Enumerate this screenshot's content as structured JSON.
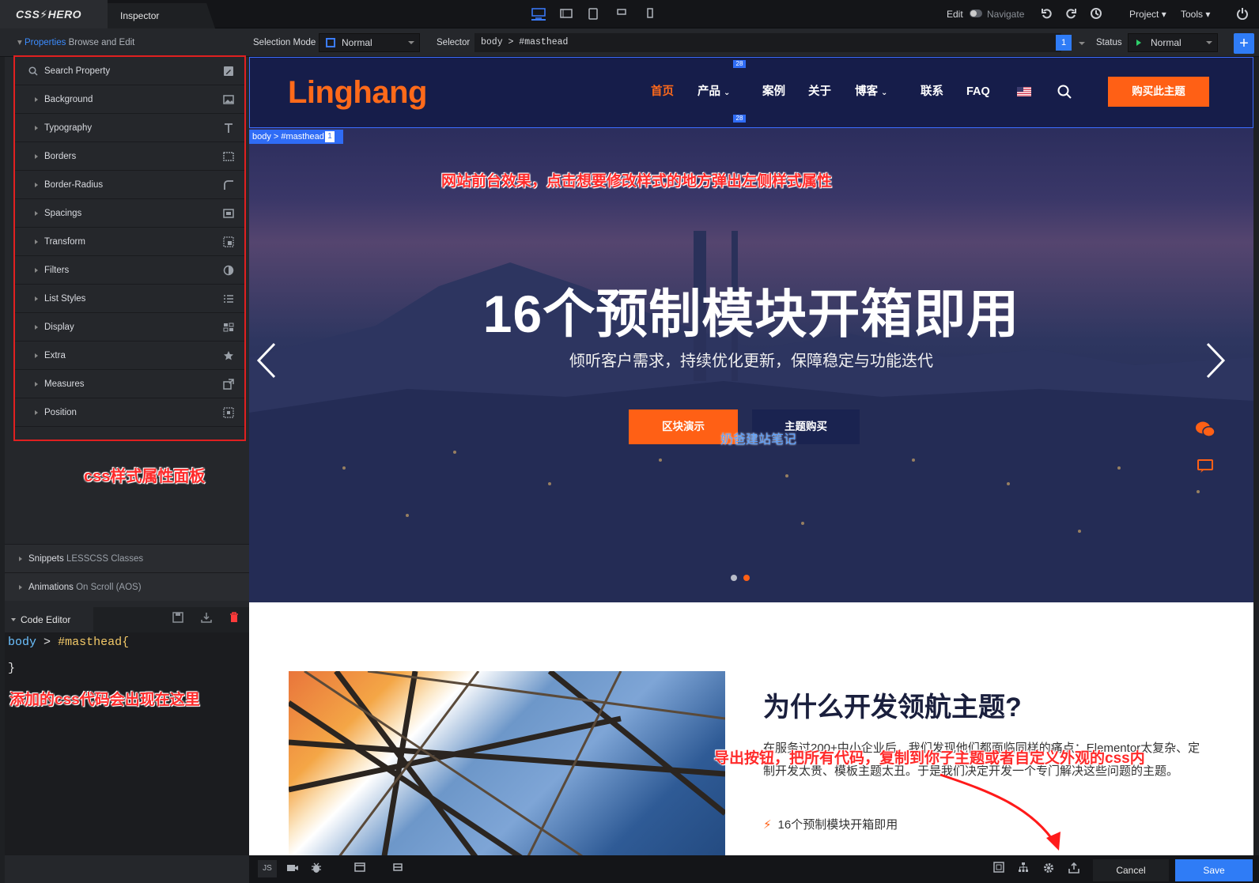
{
  "app": {
    "logo": "CSS⚡HERO",
    "tab_label": "Inspector"
  },
  "toolbar": {
    "edit_label": "Edit",
    "navigate_label": "Navigate",
    "project_label": "Project",
    "tools_label": "Tools"
  },
  "bar2": {
    "properties_label": "Properties",
    "properties_sub": "Browse and Edit",
    "selection_mode_label": "Selection Mode",
    "selection_mode_value": "Normal",
    "selector_label": "Selector",
    "selector_value": "body  >  #masthead",
    "selector_count": "1",
    "status_label": "Status",
    "status_value": "Normal",
    "add_label": "+"
  },
  "properties": {
    "search_placeholder": "Search Property",
    "items": [
      {
        "label": "Background",
        "icon": "image-icon"
      },
      {
        "label": "Typography",
        "icon": "text-icon"
      },
      {
        "label": "Borders",
        "icon": "border-icon"
      },
      {
        "label": "Border-Radius",
        "icon": "radius-icon"
      },
      {
        "label": "Spacings",
        "icon": "spacing-icon"
      },
      {
        "label": "Transform",
        "icon": "transform-icon"
      },
      {
        "label": "Filters",
        "icon": "filter-icon"
      },
      {
        "label": "List Styles",
        "icon": "list-icon"
      },
      {
        "label": "Display",
        "icon": "display-icon"
      },
      {
        "label": "Extra",
        "icon": "star-icon"
      },
      {
        "label": "Measures",
        "icon": "measure-icon"
      },
      {
        "label": "Position",
        "icon": "position-icon"
      }
    ]
  },
  "annotations": {
    "panel": "css样式属性面板",
    "site": "网站前台效果，点击想要修改样式的地方弹出左侧样式属性",
    "code": "添加的css代码会出现在这里",
    "export": "导出按钮，把所有代码，复制到你子主题或者自定义外观的css内"
  },
  "accordions": {
    "snippets": {
      "label": "Snippets",
      "sub": "LESSCSS Classes"
    },
    "animations": {
      "label": "Animations",
      "sub": "On Scroll (AOS)"
    }
  },
  "code_editor": {
    "title": "Code Editor",
    "selector": "body",
    "combinator": ">",
    "id": "#masthead{",
    "close": "}"
  },
  "site": {
    "brand": "Linghang",
    "nav": [
      "首页",
      "产品",
      "案例",
      "关于",
      "博客",
      "联系",
      "FAQ"
    ],
    "buy_button": "购买此主题",
    "spacing_tag": "28",
    "crumb": "body > #masthead",
    "crumb_count": "1",
    "hero_title": "16个预制模块开箱即用",
    "hero_subtitle": "倾听客户需求，持续优化更新，保障稳定与功能迭代",
    "btn_demo": "区块演示",
    "btn_buy": "主题购买",
    "watermark": "奶爸建站笔记",
    "about_title": "为什么开发领航主题?",
    "about_text": "在服务过200+中小企业后，我们发现他们都面临同样的痛点：Elementor太复杂、定制开发太贵、模板主题太丑。于是我们决定开发一个专门解决这些问题的主题。",
    "feature_1": "16个预制模块开箱即用"
  },
  "bottom": {
    "js_label": "JS",
    "cancel": "Cancel",
    "save": "Save"
  },
  "colors": {
    "accent": "#2f7cf6",
    "brand_orange": "#ff6015",
    "annotation_red": "#ff2a2a"
  }
}
